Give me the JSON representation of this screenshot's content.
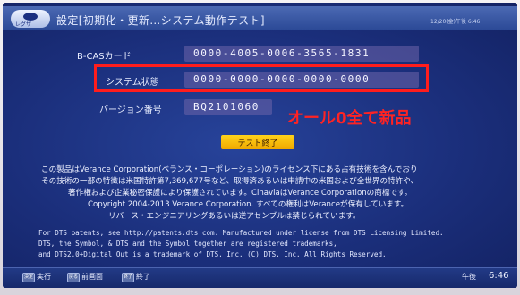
{
  "header": {
    "logo_text": "レグザ",
    "title": "設定[初期化・更新…システム動作テスト]",
    "datetime": "12/20(金)午後 6:46"
  },
  "fields": [
    {
      "label": "B-CASカード",
      "value": "0000-4005-0006-3565-1831"
    },
    {
      "label": "システム状態",
      "value": "0000-0000-0000-0000-0000"
    },
    {
      "label": "バージョン番号",
      "value": "BQ2101060"
    }
  ],
  "annotation": "オール0全て新品",
  "test_end_button": "テスト終了",
  "license_lines": [
    "この製品はVerance Corporation(ベランス・コーポレーション)のライセンス下にある占有技術を含んでおり",
    "その技術の一部の特徴は米国特許第7,369,677号など、取得済あるいは申請中の米国および全世界の特許や、",
    "著作権および企業秘密保護により保護されています。CinaviaはVerance Corporationの商標です。",
    "Copyright 2004-2013 Verance Corporation. すべての権利はVeranceが保有しています。",
    "リバース・エンジニアリングあるいは逆アセンブルは禁じられています。"
  ],
  "dts_lines": [
    "For DTS patents, see http://patents.dts.com. Manufactured under license from DTS Licensing Limited.",
    "DTS, the Symbol, & DTS and the Symbol together are registered trademarks,",
    "and DTS2.0+Digital Out is a trademark of DTS, Inc. (C) DTS, Inc. All Rights Reserved."
  ],
  "footer": {
    "keys": [
      {
        "key": "決定",
        "label": "実行"
      },
      {
        "key": "戻る",
        "label": "前画面"
      },
      {
        "key": "終了",
        "label": "終了"
      }
    ],
    "ampm": "午後",
    "time": "6:46"
  }
}
